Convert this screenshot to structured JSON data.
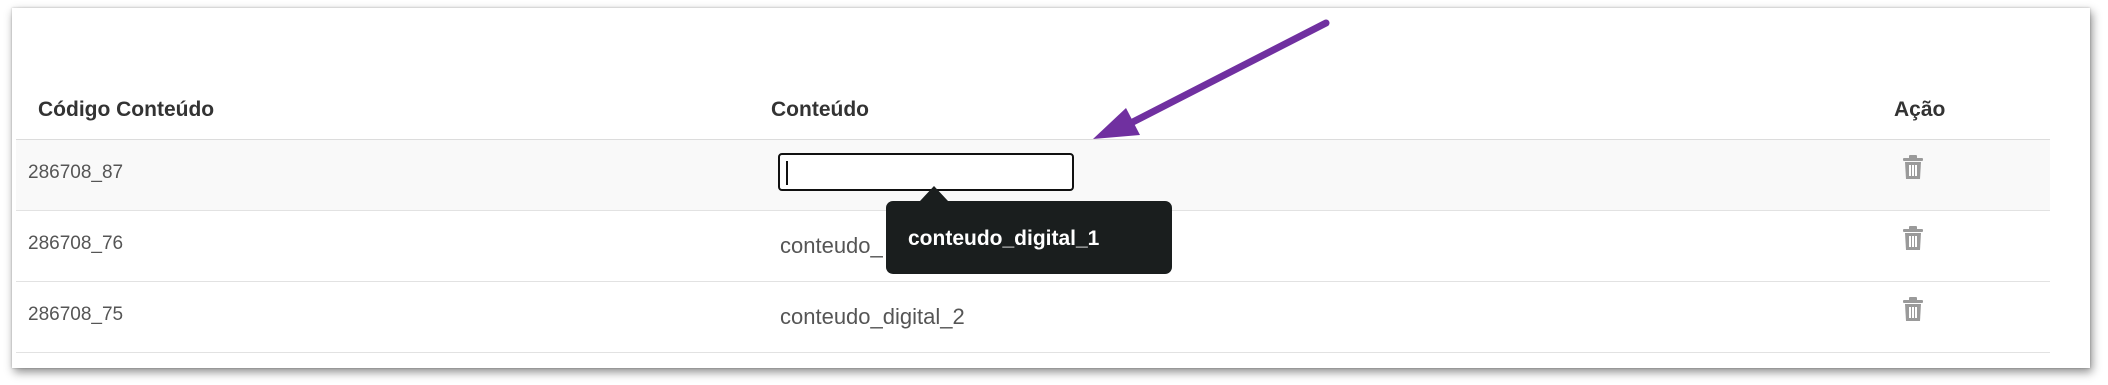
{
  "table": {
    "headers": {
      "code": "Código Conteúdo",
      "content": "Conteúdo",
      "action": "Ação"
    },
    "rows": [
      {
        "code": "286708_87",
        "content": "",
        "editing": true
      },
      {
        "code": "286708_76",
        "content": "conteudo_"
      },
      {
        "code": "286708_75",
        "content": "conteudo_digital_2"
      }
    ]
  },
  "tooltip": {
    "text": "conteudo_digital_1"
  },
  "icons": {
    "row_action": "trash-icon"
  },
  "colors": {
    "annotation_arrow": "#7030a0",
    "tooltip_background": "#1a1e1e",
    "header_text": "#333333",
    "cell_text": "#555555"
  }
}
